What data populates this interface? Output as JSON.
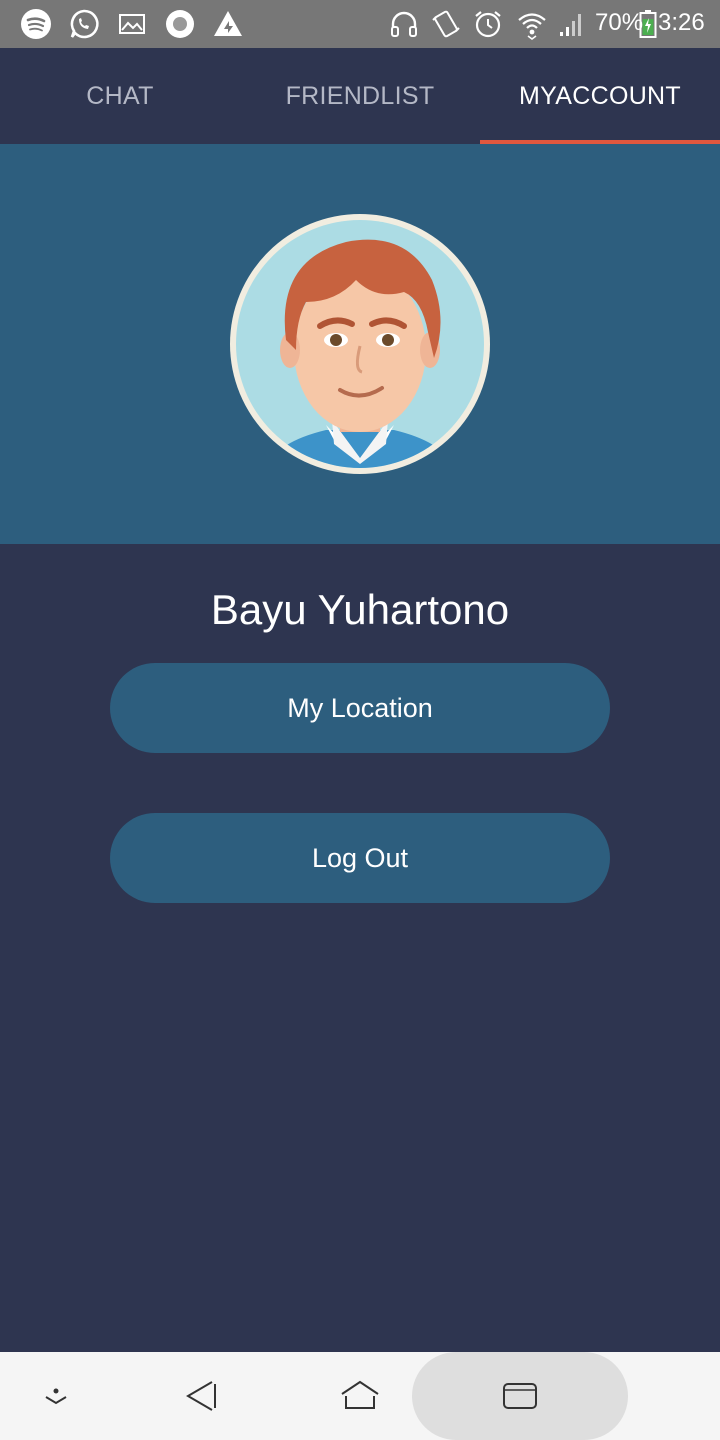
{
  "status_bar": {
    "battery": "70%",
    "time": "3:26",
    "left_icons": [
      "spotify-icon",
      "whatsapp-icon",
      "gallery-icon",
      "record-icon",
      "airdroid-icon"
    ],
    "right_icons": [
      "headphones-icon",
      "vibrate-icon",
      "alarm-icon",
      "wifi-icon",
      "signal-icon",
      "battery-icon"
    ]
  },
  "tabs": [
    {
      "label": "CHAT",
      "active": false
    },
    {
      "label": "FRIENDLIST",
      "active": false
    },
    {
      "label": "MYACCOUNT",
      "active": true
    }
  ],
  "profile": {
    "name": "Bayu Yuhartono"
  },
  "actions": {
    "location_label": "My Location",
    "logout_label": "Log Out"
  },
  "nav_bar": {
    "icons": [
      "hide-nav-icon",
      "back-icon",
      "home-icon",
      "recents-icon"
    ]
  },
  "colors": {
    "background": "#2e3550",
    "header": "#2d5e7e",
    "button": "#2d5e7e",
    "tab_indicator": "#e0573e",
    "status_bar": "#777777"
  }
}
